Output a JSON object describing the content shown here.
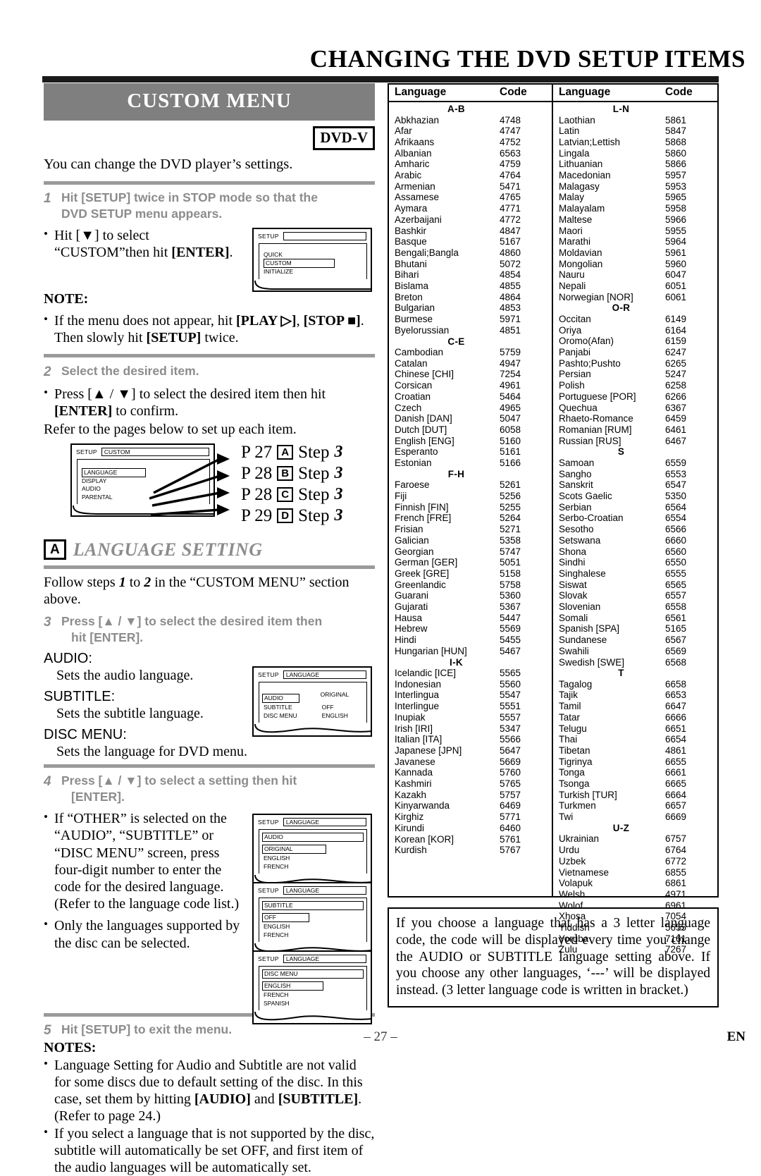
{
  "header": {
    "title": "CHANGING THE DVD SETUP ITEMS"
  },
  "custom_menu": {
    "banner": "CUSTOM MENU",
    "badge": "DVD-V",
    "lead": "You can change the DVD player’s settings.",
    "step1": {
      "num": "1",
      "line1": "Hit [SETUP] twice in STOP mode so that the",
      "line2": "DVD SETUP menu appears."
    },
    "bullet1_line1": "Hit [▼] to select",
    "bullet1_line2_a": "“CUSTOM”then hit ",
    "bullet1_line2_b": "[ENTER]",
    "bullet1_line2_c": ".",
    "note_heading": "NOTE:",
    "note_a": "If the menu does not appear, hit ",
    "note_b": "[PLAY ▷]",
    "note_c": ", ",
    "note_d": "[STOP ■]",
    "note_e": ". Then slowly hit ",
    "note_f": "[SETUP]",
    "note_g": " twice.",
    "step2": {
      "num": "2",
      "line1": "Select the desired item."
    },
    "bullet2_a": "Press [▲ / ▼] to select the desired item then hit ",
    "bullet2_b": "[ENTER]",
    "bullet2_c": " to confirm.",
    "refer": "Refer to the pages below to set up each item.",
    "osd_setup": {
      "label": "SETUP",
      "title": "",
      "items": [
        "QUICK",
        "CUSTOM",
        "INITIALIZE"
      ],
      "selected": "CUSTOM"
    },
    "osd_custom": {
      "label": "SETUP",
      "title": "CUSTOM",
      "items": [
        "LANGUAGE",
        "DISPLAY",
        "AUDIO",
        "PARENTAL"
      ],
      "selected": "LANGUAGE"
    },
    "page_refs": [
      {
        "page": "P 27",
        "letter": "A",
        "step": "Step",
        "num": "3"
      },
      {
        "page": "P 28",
        "letter": "B",
        "step": "Step",
        "num": "3"
      },
      {
        "page": "P 28",
        "letter": "C",
        "step": "Step",
        "num": "3"
      },
      {
        "page": "P 29",
        "letter": "D",
        "step": "Step",
        "num": "3"
      }
    ]
  },
  "language_setting": {
    "letter": "A",
    "title": "LANGUAGE SETTING",
    "follow_a": "Follow steps ",
    "follow_1": "1",
    "follow_b": " to ",
    "follow_2": "2",
    "follow_c": " in the “CUSTOM MENU” section above.",
    "step3": {
      "num": "3",
      "line1": "Press [▲ / ▼] to select the desired item then",
      "line2": "hit [ENTER]."
    },
    "items": [
      {
        "name": "AUDIO:",
        "desc": "Sets the audio language."
      },
      {
        "name": "SUBTITLE:",
        "desc": "Sets the subtitle language."
      },
      {
        "name": "DISC MENU:",
        "desc": "Sets the language for DVD menu."
      }
    ],
    "osd_language": {
      "label": "SETUP",
      "title": "LANGUAGE",
      "rows": [
        {
          "l": "AUDIO",
          "r": "ORIGINAL"
        },
        {
          "l": "SUBTITLE",
          "r": "OFF"
        },
        {
          "l": "DISC MENU",
          "r": "ENGLISH"
        }
      ],
      "selected": "AUDIO"
    },
    "step4": {
      "num": "4",
      "line1": "Press [▲ / ▼] to select a setting then hit",
      "line2": "[ENTER]."
    },
    "bullet4": "If “OTHER” is selected on the “AUDIO”, “SUBTITLE” or “DISC MENU” screen, press four-digit number to enter the code for the desired language. (Refer to the language code list.)",
    "bullet5": "Only the languages supported by the disc can be selected.",
    "osd_audio": {
      "label": "SETUP",
      "title": "LANGUAGE",
      "header": "AUDIO",
      "items": [
        "ORIGINAL",
        "ENGLISH",
        "FRENCH"
      ],
      "selected": "ORIGINAL"
    },
    "osd_subtitle": {
      "label": "SETUP",
      "title": "LANGUAGE",
      "header": "SUBTITLE",
      "items": [
        "OFF",
        "ENGLISH",
        "FRENCH"
      ],
      "selected": "OFF"
    },
    "osd_discmenu": {
      "label": "SETUP",
      "title": "LANGUAGE",
      "header": "DISC MENU",
      "items": [
        "ENGLISH",
        "FRENCH",
        "SPANISH"
      ],
      "selected": "ENGLISH"
    },
    "step5": {
      "num": "5",
      "line1": "Hit [SETUP] to exit the menu."
    },
    "notes_heading": "NOTES:",
    "note1_a": "Language Setting for Audio and Subtitle are not valid for some discs due to default setting of the disc. In this case, set them by hitting ",
    "note1_b": "[AUDIO]",
    "note1_c": " and ",
    "note1_d": "[SUBTITLE]",
    "note1_e": ". (Refer to page 24.)",
    "note2": "If you select a language that is not supported by the disc, subtitle will automatically be set OFF, and first item of the audio languages will be automatically set."
  },
  "code_table": {
    "headers": {
      "language": "Language",
      "code": "Code"
    },
    "left": [
      {
        "group": "A-B"
      },
      {
        "name": "Abkhazian",
        "code": "4748"
      },
      {
        "name": "Afar",
        "code": "4747"
      },
      {
        "name": "Afrikaans",
        "code": "4752"
      },
      {
        "name": "Albanian",
        "code": "6563"
      },
      {
        "name": "Amharic",
        "code": "4759"
      },
      {
        "name": "Arabic",
        "code": "4764"
      },
      {
        "name": "Armenian",
        "code": "5471"
      },
      {
        "name": "Assamese",
        "code": "4765"
      },
      {
        "name": "Aymara",
        "code": "4771"
      },
      {
        "name": "Azerbaijani",
        "code": "4772"
      },
      {
        "name": "Bashkir",
        "code": "4847"
      },
      {
        "name": "Basque",
        "code": "5167"
      },
      {
        "name": "Bengali;Bangla",
        "code": "4860"
      },
      {
        "name": "Bhutani",
        "code": "5072"
      },
      {
        "name": "Bihari",
        "code": "4854"
      },
      {
        "name": "Bislama",
        "code": "4855"
      },
      {
        "name": "Breton",
        "code": "4864"
      },
      {
        "name": "Bulgarian",
        "code": "4853"
      },
      {
        "name": "Burmese",
        "code": "5971"
      },
      {
        "name": "Byelorussian",
        "code": "4851"
      },
      {
        "group": "C-E"
      },
      {
        "name": "Cambodian",
        "code": "5759"
      },
      {
        "name": "Catalan",
        "code": "4947"
      },
      {
        "name": "Chinese [CHI]",
        "code": "7254"
      },
      {
        "name": "Corsican",
        "code": "4961"
      },
      {
        "name": "Croatian",
        "code": "5464"
      },
      {
        "name": "Czech",
        "code": "4965"
      },
      {
        "name": "Danish [DAN]",
        "code": "5047"
      },
      {
        "name": "Dutch [DUT]",
        "code": "6058"
      },
      {
        "name": "English [ENG]",
        "code": "5160"
      },
      {
        "name": "Esperanto",
        "code": "5161"
      },
      {
        "name": "Estonian",
        "code": "5166"
      },
      {
        "group": "F-H"
      },
      {
        "name": "Faroese",
        "code": "5261"
      },
      {
        "name": "Fiji",
        "code": "5256"
      },
      {
        "name": "Finnish [FIN]",
        "code": "5255"
      },
      {
        "name": "French [FRE]",
        "code": "5264"
      },
      {
        "name": "Frisian",
        "code": "5271"
      },
      {
        "name": "Galician",
        "code": "5358"
      },
      {
        "name": "Georgian",
        "code": "5747"
      },
      {
        "name": "German [GER]",
        "code": "5051"
      },
      {
        "name": "Greek [GRE]",
        "code": "5158"
      },
      {
        "name": "Greenlandic",
        "code": "5758"
      },
      {
        "name": "Guarani",
        "code": "5360"
      },
      {
        "name": "Gujarati",
        "code": "5367"
      },
      {
        "name": "Hausa",
        "code": "5447"
      },
      {
        "name": "Hebrew",
        "code": "5569"
      },
      {
        "name": "Hindi",
        "code": "5455"
      },
      {
        "name": "Hungarian [HUN]",
        "code": "5467"
      },
      {
        "group": "I-K"
      },
      {
        "name": "Icelandic [ICE]",
        "code": "5565"
      },
      {
        "name": "Indonesian",
        "code": "5560"
      },
      {
        "name": "Interlingua",
        "code": "5547"
      },
      {
        "name": "Interlingue",
        "code": "5551"
      },
      {
        "name": "Inupiak",
        "code": "5557"
      },
      {
        "name": "Irish [IRI]",
        "code": "5347"
      },
      {
        "name": "Italian [ITA]",
        "code": "5566"
      },
      {
        "name": "Japanese [JPN]",
        "code": "5647"
      },
      {
        "name": "Javanese",
        "code": "5669"
      },
      {
        "name": "Kannada",
        "code": "5760"
      },
      {
        "name": "Kashmiri",
        "code": "5765"
      },
      {
        "name": "Kazakh",
        "code": "5757"
      },
      {
        "name": "Kinyarwanda",
        "code": "6469"
      },
      {
        "name": "Kirghiz",
        "code": "5771"
      },
      {
        "name": "Kirundi",
        "code": "6460"
      },
      {
        "name": "Korean [KOR]",
        "code": "5761"
      },
      {
        "name": "Kurdish",
        "code": "5767"
      }
    ],
    "right": [
      {
        "group": "L-N"
      },
      {
        "name": "Laothian",
        "code": "5861"
      },
      {
        "name": "Latin",
        "code": "5847"
      },
      {
        "name": "Latvian;Lettish",
        "code": "5868"
      },
      {
        "name": "Lingala",
        "code": "5860"
      },
      {
        "name": "Lithuanian",
        "code": "5866"
      },
      {
        "name": "Macedonian",
        "code": "5957"
      },
      {
        "name": "Malagasy",
        "code": "5953"
      },
      {
        "name": "Malay",
        "code": "5965"
      },
      {
        "name": "Malayalam",
        "code": "5958"
      },
      {
        "name": "Maltese",
        "code": "5966"
      },
      {
        "name": "Maori",
        "code": "5955"
      },
      {
        "name": "Marathi",
        "code": "5964"
      },
      {
        "name": "Moldavian",
        "code": "5961"
      },
      {
        "name": "Mongolian",
        "code": "5960"
      },
      {
        "name": "Nauru",
        "code": "6047"
      },
      {
        "name": "Nepali",
        "code": "6051"
      },
      {
        "name": "Norwegian [NOR]",
        "code": "6061"
      },
      {
        "group": "O-R"
      },
      {
        "name": "Occitan",
        "code": "6149"
      },
      {
        "name": "Oriya",
        "code": "6164"
      },
      {
        "name": "Oromo(Afan)",
        "code": "6159"
      },
      {
        "name": "Panjabi",
        "code": "6247"
      },
      {
        "name": "Pashto;Pushto",
        "code": "6265"
      },
      {
        "name": "Persian",
        "code": "5247"
      },
      {
        "name": "Polish",
        "code": "6258"
      },
      {
        "name": "Portuguese [POR]",
        "code": "6266"
      },
      {
        "name": "Quechua",
        "code": "6367"
      },
      {
        "name": "Rhaeto-Romance",
        "code": "6459"
      },
      {
        "name": "Romanian [RUM]",
        "code": "6461"
      },
      {
        "name": "Russian [RUS]",
        "code": "6467"
      },
      {
        "group": "S"
      },
      {
        "name": "Samoan",
        "code": "6559"
      },
      {
        "name": "Sangho",
        "code": "6553"
      },
      {
        "name": "Sanskrit",
        "code": "6547"
      },
      {
        "name": "Scots Gaelic",
        "code": "5350"
      },
      {
        "name": "Serbian",
        "code": "6564"
      },
      {
        "name": "Serbo-Croatian",
        "code": "6554"
      },
      {
        "name": "Sesotho",
        "code": "6566"
      },
      {
        "name": "Setswana",
        "code": "6660"
      },
      {
        "name": "Shona",
        "code": "6560"
      },
      {
        "name": "Sindhi",
        "code": "6550"
      },
      {
        "name": "Singhalese",
        "code": "6555"
      },
      {
        "name": "Siswat",
        "code": "6565"
      },
      {
        "name": "Slovak",
        "code": "6557"
      },
      {
        "name": "Slovenian",
        "code": "6558"
      },
      {
        "name": "Somali",
        "code": "6561"
      },
      {
        "name": "Spanish [SPA]",
        "code": "5165"
      },
      {
        "name": "Sundanese",
        "code": "6567"
      },
      {
        "name": "Swahili",
        "code": "6569"
      },
      {
        "name": "Swedish [SWE]",
        "code": "6568"
      },
      {
        "group": "T"
      },
      {
        "name": "Tagalog",
        "code": "6658"
      },
      {
        "name": "Tajik",
        "code": "6653"
      },
      {
        "name": "Tamil",
        "code": "6647"
      },
      {
        "name": "Tatar",
        "code": "6666"
      },
      {
        "name": "Telugu",
        "code": "6651"
      },
      {
        "name": "Thai",
        "code": "6654"
      },
      {
        "name": "Tibetan",
        "code": "4861"
      },
      {
        "name": "Tigrinya",
        "code": "6655"
      },
      {
        "name": "Tonga",
        "code": "6661"
      },
      {
        "name": "Tsonga",
        "code": "6665"
      },
      {
        "name": "Turkish [TUR]",
        "code": "6664"
      },
      {
        "name": "Turkmen",
        "code": "6657"
      },
      {
        "name": "Twi",
        "code": "6669"
      },
      {
        "group": "U-Z"
      },
      {
        "name": "Ukrainian",
        "code": "6757"
      },
      {
        "name": "Urdu",
        "code": "6764"
      },
      {
        "name": "Uzbek",
        "code": "6772"
      },
      {
        "name": "Vietnamese",
        "code": "6855"
      },
      {
        "name": "Volapuk",
        "code": "6861"
      },
      {
        "name": "Welsh",
        "code": "4971"
      },
      {
        "name": "Wolof",
        "code": "6961"
      },
      {
        "name": "Xhosa",
        "code": "7054"
      },
      {
        "name": "Yiddish",
        "code": "5655"
      },
      {
        "name": "Yoruba",
        "code": "7161"
      },
      {
        "name": "Zulu",
        "code": "7267"
      }
    ]
  },
  "bottom_note": "If you choose a language that has a 3 letter language code, the code will be displayed every time you change the AUDIO or SUBTITLE language setting above. If you choose any other languages, ‘---’ will be displayed instead. (3 letter language code is written in bracket.)",
  "footer": {
    "page": "– 27 –",
    "lang": "EN"
  }
}
